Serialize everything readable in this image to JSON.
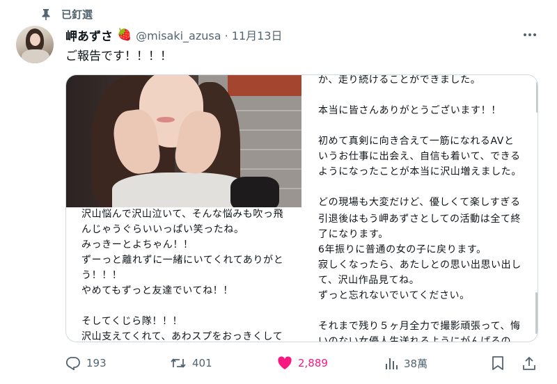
{
  "pinned": {
    "label": "已釘選"
  },
  "tweet": {
    "display_name": "岬あずさ",
    "emoji": "🍓",
    "meta": "@misaki_azusa · 11月13日",
    "text": "ご報告です！！！！"
  },
  "media": {
    "top_right": [
      "か、走り続けることができました。",
      "",
      "本当に皆さんありがとうございます！！",
      "",
      "初めて真剣に向き合えて一筋になれるAVと",
      "いうお仕事に出会え、自信も着いて、できる",
      "ようになったことが本当に沢山増えました。",
      "",
      "どの現場も大変だけど、優しくて楽しすぎる"
    ],
    "bottom_left": [
      "沢山悩んで沢山泣いて、そんな悩みも吹っ飛",
      "んじゃうぐらいいっぱい笑ったね。",
      "みっきーとよちゃん！！",
      "ずーっと離れずに一緒にいてくれてありがと",
      "う！！！",
      "やめてもずっと友達でいてね！！",
      "",
      "そしてくじら隊！！！",
      "沢山支えてくれて、あわスプをおっきくして"
    ],
    "bottom_right": [
      "引退後はもう岬あずさとしての活動は全て終",
      "了になります。",
      "6年振りに普通の女の子に戻ります。",
      "寂しくなったら、あたしとの思い出思い出し",
      "て、沢山作品見てね。",
      "ずっと忘れないでいてください。",
      "",
      "それまで残り５ヶ月全力で撮影頑張って、悔",
      "いのない女優人生送れるようにがんばるの"
    ]
  },
  "actions": {
    "replies": "193",
    "retweets": "401",
    "likes": "2,889",
    "views": "38萬"
  },
  "colors": {
    "like": "#f91880",
    "muted": "#536471",
    "text": "#0f1419",
    "border": "#cfd9de"
  }
}
